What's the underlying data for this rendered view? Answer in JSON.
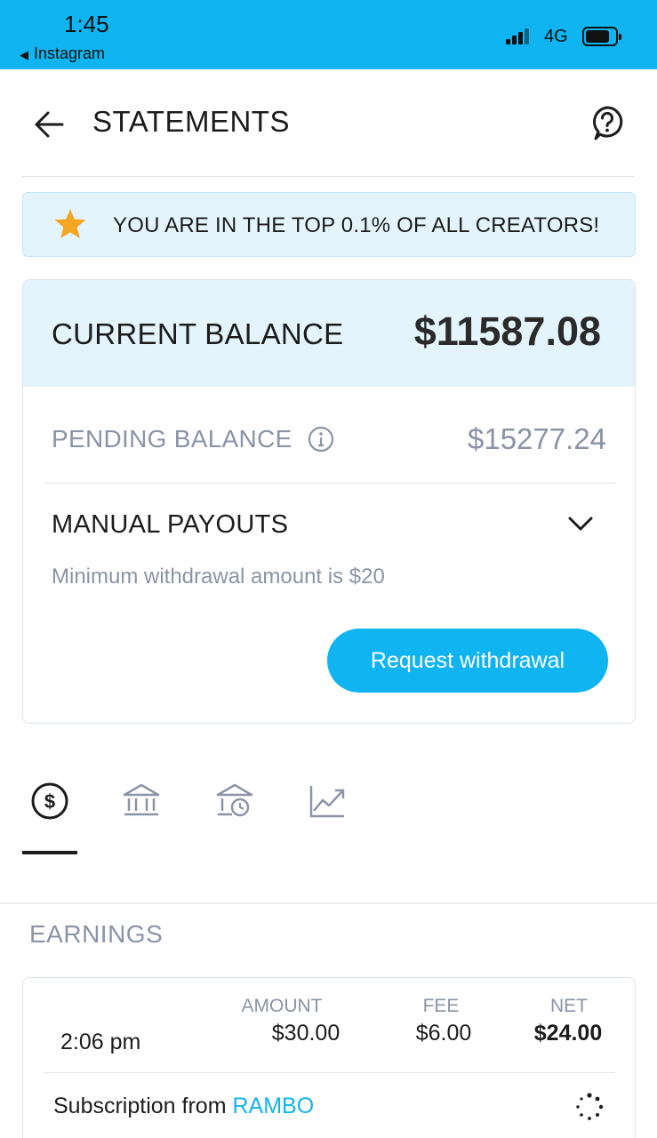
{
  "status_bar": {
    "time": "1:45",
    "back_app": "Instagram",
    "network": "4G",
    "battery_level": 0.8,
    "bg_color": "#0fb4f0"
  },
  "header": {
    "title": "STATEMENTS"
  },
  "banner": {
    "text": "YOU ARE IN THE TOP 0.1% OF ALL CREATORS!",
    "icon": "star-icon",
    "star_color": "#f5a623"
  },
  "balance": {
    "current_label": "CURRENT BALANCE",
    "current_value": "$11587.08",
    "pending_label": "PENDING BALANCE",
    "pending_value": "$15277.24",
    "manual_label": "MANUAL PAYOUTS",
    "min_text": "Minimum withdrawal amount is $20",
    "withdraw_button": "Request withdrawal",
    "accent_color": "#0fb4f0"
  },
  "tabs": [
    {
      "icon": "dollar-icon",
      "active": true
    },
    {
      "icon": "bank-icon",
      "active": false
    },
    {
      "icon": "bank-clock-icon",
      "active": false
    },
    {
      "icon": "chart-trend-icon",
      "active": false
    }
  ],
  "earnings": {
    "title": "EARNINGS",
    "columns": {
      "amount": "AMOUNT",
      "fee": "FEE",
      "net": "NET"
    },
    "rows": [
      {
        "time": "2:06 pm",
        "amount": "$30.00",
        "fee": "$6.00",
        "net": "$24.00",
        "description": "Subscription from ",
        "from": "RAMBO"
      }
    ]
  }
}
